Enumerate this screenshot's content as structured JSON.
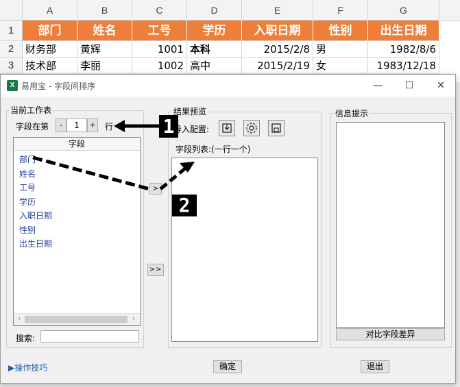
{
  "sheet": {
    "columns": [
      "A",
      "B",
      "C",
      "D",
      "E",
      "F",
      "G"
    ],
    "row_numbers": [
      "1",
      "2",
      "3"
    ],
    "header": [
      "部门",
      "姓名",
      "工号",
      "学历",
      "入职日期",
      "性别",
      "出生日期"
    ],
    "rows": [
      [
        "财务部",
        "黄辉",
        "1001",
        "本科",
        "2015/2/8",
        "男",
        "1982/8/6"
      ],
      [
        "技术部",
        "李丽",
        "1002",
        "高中",
        "2015/2/19",
        "女",
        "1983/12/18"
      ]
    ]
  },
  "dialog": {
    "title": "易用宝 - 字段间排序",
    "app_icon": "X",
    "window_controls": {
      "minimize": "—",
      "maximize": "☐",
      "close": "✕"
    },
    "left_panel": {
      "group_label": "当前工作表",
      "row_label_prefix": "字段在第",
      "row_value": "1",
      "row_label_suffix": "行",
      "minus": "-",
      "plus": "+",
      "list_header": "字段",
      "fields": [
        "部门",
        "姓名",
        "工号",
        "学历",
        "入职日期",
        "性别",
        "出生日期"
      ],
      "search_label": "搜索:",
      "search_value": ""
    },
    "move_buttons": {
      "single": ">",
      "all": ">>"
    },
    "middle_panel": {
      "group_label": "结果预览",
      "import_label": "导入配置:",
      "field_list_label": "字段列表:(一行一个)",
      "field_list_value": ""
    },
    "right_panel": {
      "group_label": "信息提示",
      "compare_button": "对比字段差异"
    },
    "footer": {
      "tips_link": "▶操作技巧",
      "ok_button": "确定",
      "exit_button": "退出"
    },
    "annotations": {
      "marker1": "1",
      "marker2": "2"
    }
  }
}
